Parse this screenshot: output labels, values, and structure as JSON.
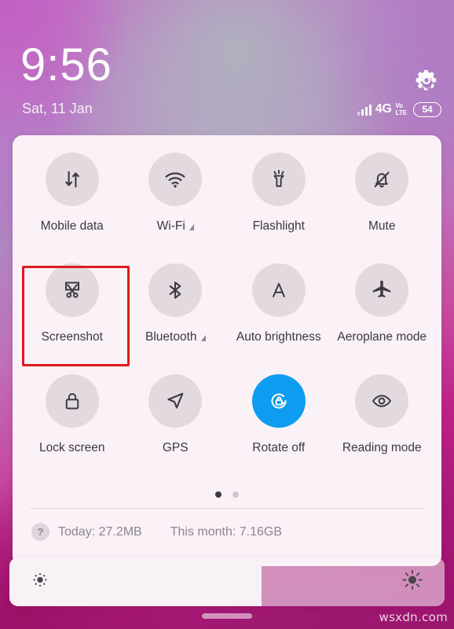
{
  "statusbar": {
    "clock": "9:56",
    "date": "Sat, 11 Jan",
    "network_label": "4G",
    "volte_top": "Vo",
    "volte_bottom": "LTE",
    "battery_level": "54",
    "settings_icon": "gear-icon",
    "signal_icon": "signal-bars-icon"
  },
  "panel": {
    "rows": [
      {
        "tiles": [
          {
            "label": "Mobile data",
            "icon": "mobile-data-icon",
            "active": false,
            "expander": false
          },
          {
            "label": "Wi-Fi",
            "icon": "wifi-icon",
            "active": false,
            "expander": true
          },
          {
            "label": "Flashlight",
            "icon": "flashlight-icon",
            "active": false,
            "expander": false
          },
          {
            "label": "Mute",
            "icon": "bell-muted-icon",
            "active": false,
            "expander": false
          }
        ]
      },
      {
        "tiles": [
          {
            "label": "Screenshot",
            "icon": "screenshot-scissors-icon",
            "active": false,
            "expander": false,
            "highlighted": true
          },
          {
            "label": "Bluetooth",
            "icon": "bluetooth-icon",
            "active": false,
            "expander": true
          },
          {
            "label": "Auto brightness",
            "icon": "auto-brightness-a-icon",
            "active": false,
            "expander": false
          },
          {
            "label": "Aeroplane mode",
            "icon": "airplane-icon",
            "active": false,
            "expander": false
          }
        ]
      },
      {
        "tiles": [
          {
            "label": "Lock screen",
            "icon": "padlock-icon",
            "active": false,
            "expander": false
          },
          {
            "label": "GPS",
            "icon": "location-arrow-icon",
            "active": false,
            "expander": false
          },
          {
            "label": "Rotate off",
            "icon": "rotation-lock-icon",
            "active": true,
            "expander": false
          },
          {
            "label": "Reading mode",
            "icon": "eye-icon",
            "active": false,
            "expander": false
          }
        ]
      }
    ],
    "pager": {
      "count": 2,
      "active_index": 0
    },
    "usage": {
      "help_icon_label": "?",
      "today": "Today: 27.2MB",
      "this_month": "This month: 7.16GB"
    }
  },
  "brightness": {
    "value_percent": 58,
    "low_icon": "sun-small-icon",
    "high_icon": "sun-large-icon"
  },
  "watermark": "wsxdn.com",
  "colors": {
    "accent_active": "#0e9cf0",
    "annotation": "#e01a1a",
    "panel_bg": "#faf2f7",
    "tile_bg": "#e2dade"
  }
}
